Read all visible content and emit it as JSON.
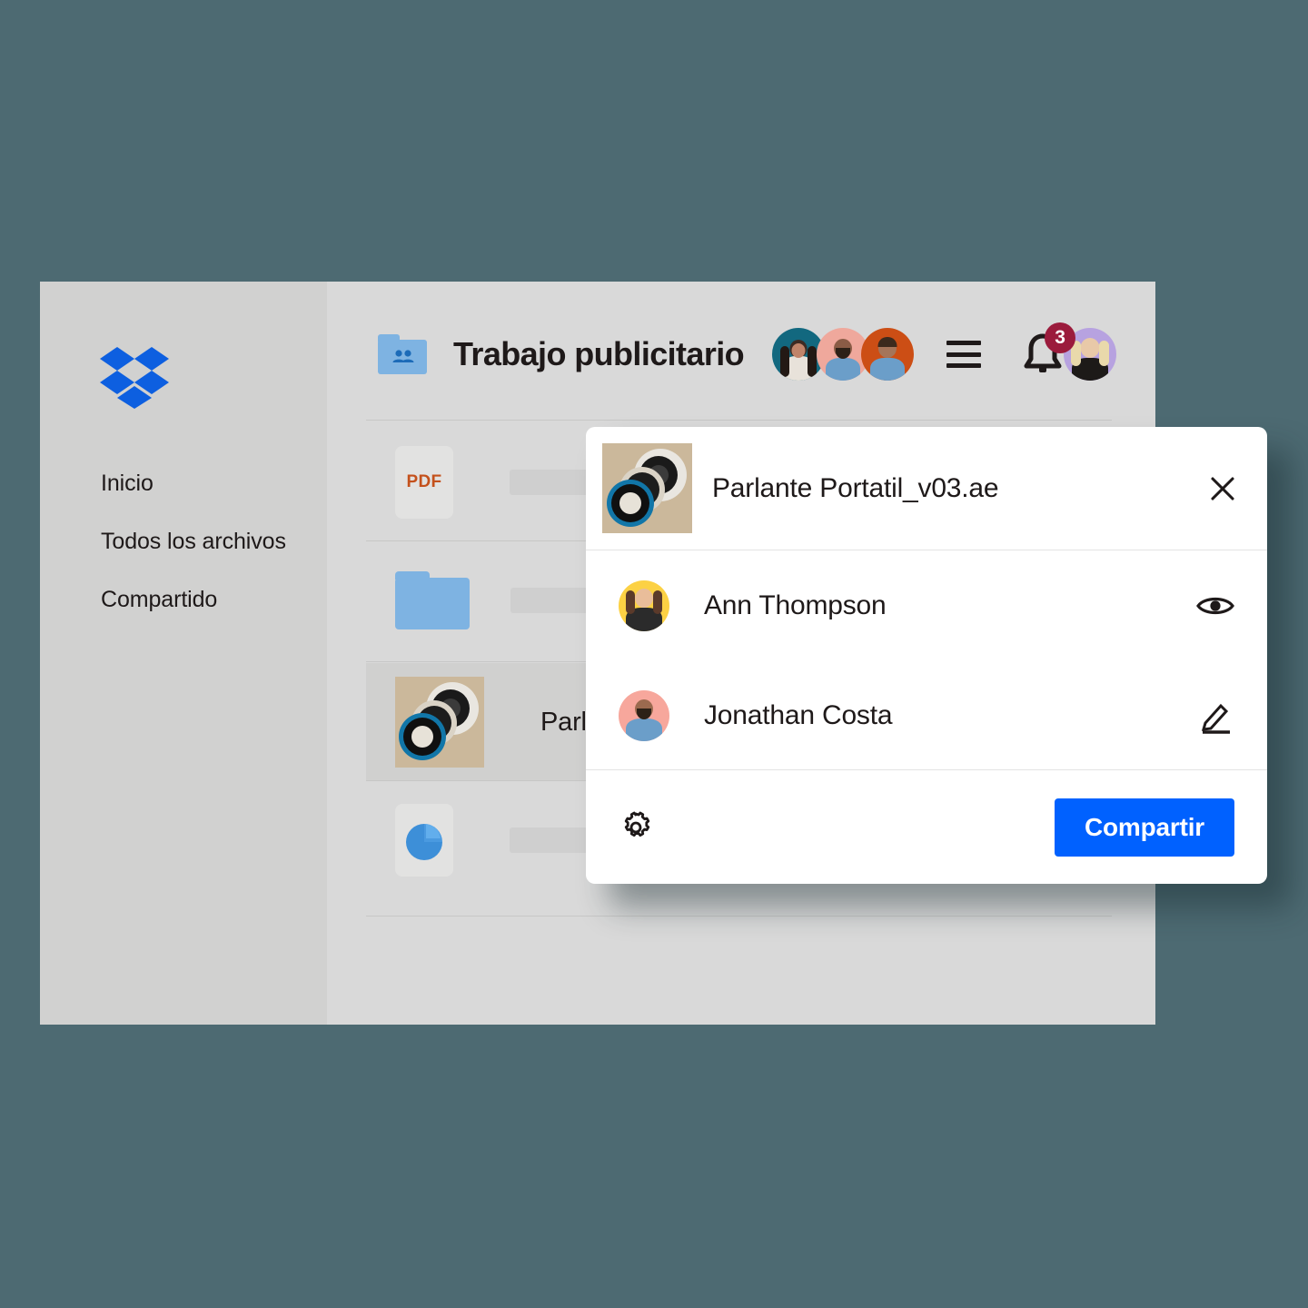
{
  "theme": {
    "page_background": "#4d6a72",
    "window_background": "#d9d9d9",
    "sidebar_background": "#d1d1d0",
    "accent_blue": "#0061ff",
    "folder_blue": "#7eb3e2",
    "badge_red": "#9b1b3c",
    "pdf_orange": "#c4511c",
    "thumb_tan": "#cbb89b"
  },
  "sidebar": {
    "logo_icon": "dropbox-logo-icon",
    "items": [
      {
        "label": "Inicio"
      },
      {
        "label": "Todos los archivos"
      },
      {
        "label": "Compartido"
      }
    ]
  },
  "header": {
    "folder_icon": "shared-folder-icon",
    "title": "Trabajo publicitario",
    "members": [
      {
        "name_icon": "member-avatar-1"
      },
      {
        "name_icon": "member-avatar-2"
      },
      {
        "name_icon": "member-avatar-3"
      }
    ],
    "menu_icon": "hamburger-menu-icon",
    "notifications": {
      "icon": "bell-icon",
      "count": "3"
    },
    "account_avatar_icon": "account-avatar-icon"
  },
  "file_list": {
    "rows": [
      {
        "icon": "pdf-file-icon",
        "icon_label": "PDF",
        "name": "",
        "selected": false
      },
      {
        "icon": "folder-icon",
        "icon_label": "",
        "name": "",
        "selected": false
      },
      {
        "icon": "speaker-thumbnail-icon",
        "icon_label": "",
        "name": "Parlante",
        "selected": true
      },
      {
        "icon": "chart-file-icon",
        "icon_label": "",
        "name": "",
        "selected": false
      }
    ]
  },
  "share_modal": {
    "thumbnail_icon": "speaker-thumbnail-icon",
    "filename": "Parlante Portatil_v03.ae",
    "close_icon": "close-icon",
    "people": [
      {
        "avatar_icon": "avatar-ann-thompson",
        "name": "Ann Thompson",
        "permission_icon": "eye-icon",
        "permission": "can view"
      },
      {
        "avatar_icon": "avatar-jonathan-costa",
        "name": "Jonathan Costa",
        "permission_icon": "pencil-icon",
        "permission": "can edit"
      }
    ],
    "settings_icon": "gear-icon",
    "share_label": "Compartir"
  }
}
